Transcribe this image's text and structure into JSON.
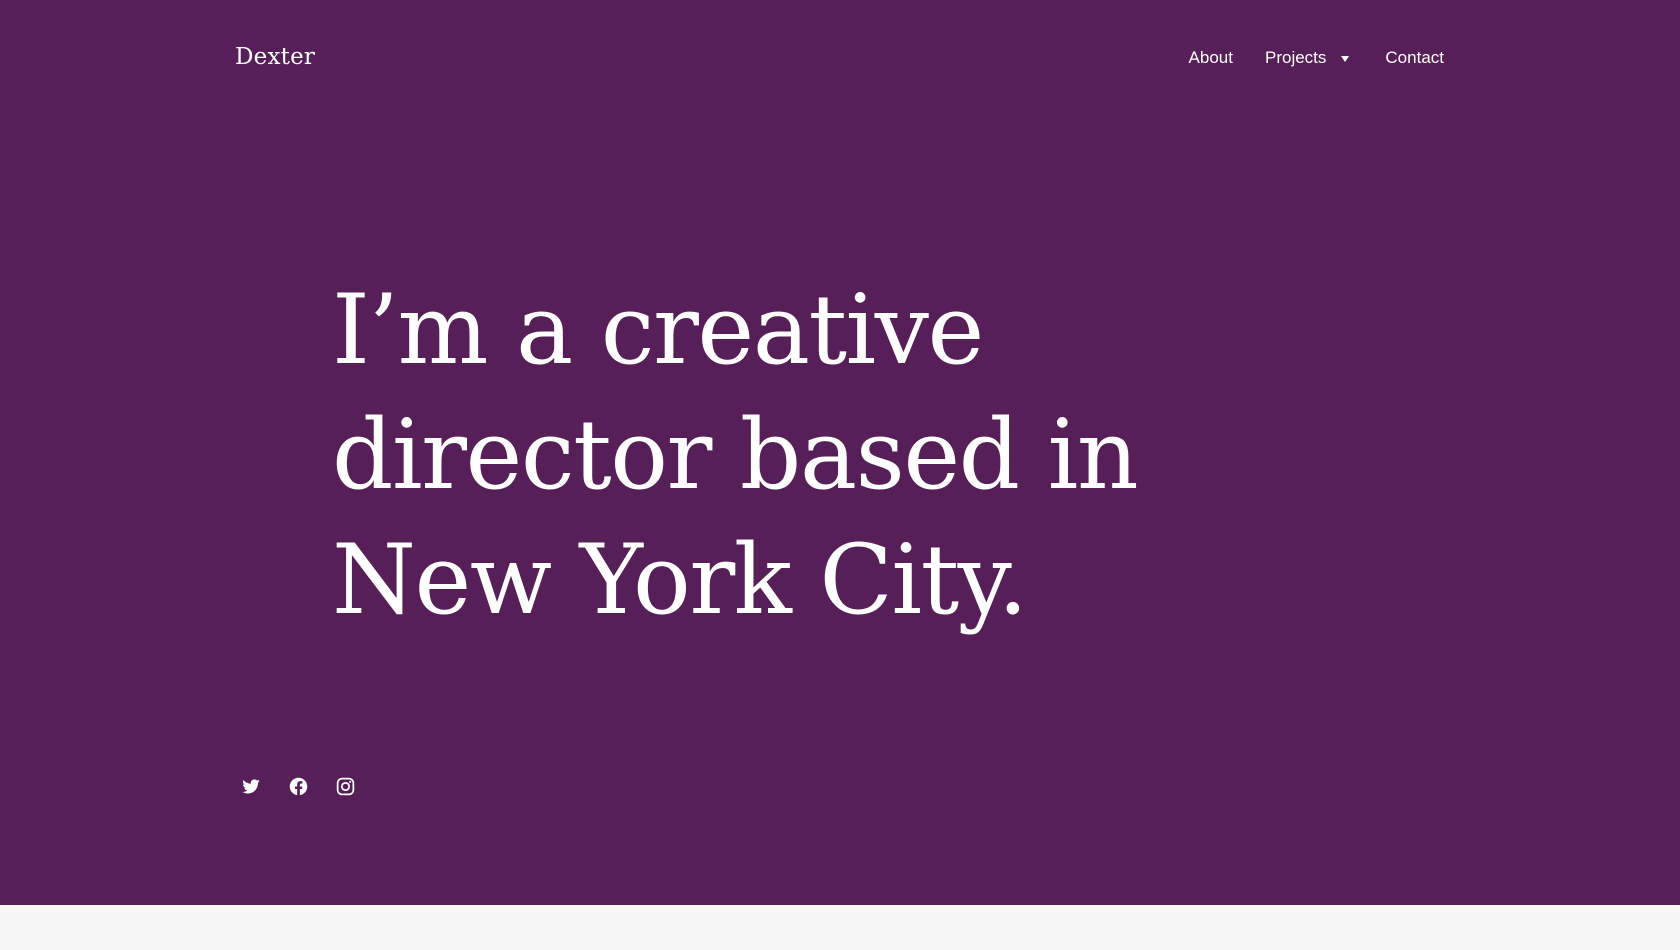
{
  "site": {
    "title": "Dexter"
  },
  "nav": {
    "items": [
      {
        "label": "About"
      },
      {
        "label": "Projects",
        "has_dropdown": true
      },
      {
        "label": "Contact"
      }
    ]
  },
  "hero": {
    "headline_lines": [
      "I’m a creative",
      "director based in",
      "New York City."
    ]
  },
  "social": {
    "icons": [
      "twitter-icon",
      "facebook-icon",
      "instagram-icon"
    ]
  },
  "colors": {
    "hero_background": "#561f57",
    "text": "#ffffff",
    "page_background": "#f7f7f7"
  }
}
